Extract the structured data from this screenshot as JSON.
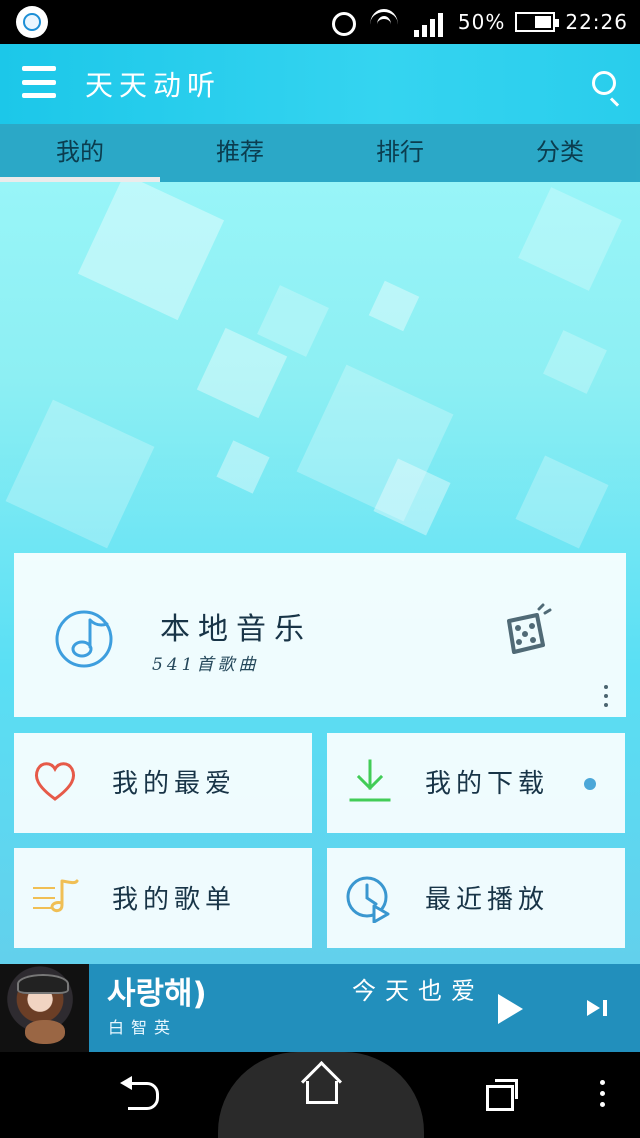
{
  "status_bar": {
    "battery_text": "50%",
    "time": "22:26",
    "icons": [
      "app-icon",
      "alarm-icon",
      "wifi-icon",
      "signal-icon",
      "battery-icon"
    ]
  },
  "app_bar": {
    "title": "天天动听",
    "left_icon": "menu-icon",
    "right_icon": "search-icon"
  },
  "tabs": [
    {
      "label": "我的",
      "active": true
    },
    {
      "label": "推荐",
      "active": false
    },
    {
      "label": "排行",
      "active": false
    },
    {
      "label": "分类",
      "active": false
    }
  ],
  "local_music": {
    "title": "本地音乐",
    "subtitle": "541首歌曲",
    "left_icon": "music-note-icon",
    "right_icon": "dice-icon"
  },
  "cards": [
    {
      "label": "我的最爱",
      "icon": "heart-icon",
      "icon_color": "#e65a49"
    },
    {
      "label": "我的下载",
      "icon": "download-icon",
      "icon_color": "#42cc57"
    },
    {
      "label": "我的歌单",
      "icon": "playlist-icon",
      "icon_color": "#f0bf55"
    },
    {
      "label": "最近播放",
      "icon": "recent-play-icon",
      "icon_color": "#3a97d0"
    }
  ],
  "player": {
    "song_title": "사랑해)",
    "extra_title": "今天也爱",
    "artist": "白智英",
    "play_icon": "play-icon",
    "next_icon": "next-icon"
  },
  "nav_bar": {
    "icons": [
      "back-icon",
      "home-icon",
      "recent-apps-icon",
      "more-icon"
    ]
  },
  "colors": {
    "app_bar": "#29cdec",
    "tab_bar": "#2fb7d8",
    "player": "#228fbc",
    "background_top": "#98f5f8",
    "background_bottom": "#5adff4"
  }
}
